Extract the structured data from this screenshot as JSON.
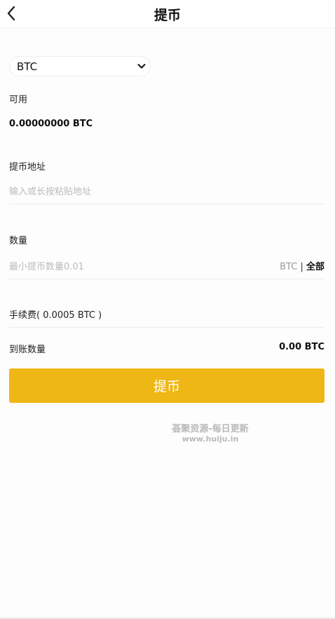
{
  "header": {
    "title": "提币"
  },
  "coin_select": {
    "value": "BTC"
  },
  "available": {
    "label": "可用",
    "balance": "0.00000000 BTC"
  },
  "address": {
    "label": "提币地址",
    "placeholder": "输入或长按粘贴地址"
  },
  "amount": {
    "label": "数量",
    "placeholder": "最小提币数量0.01",
    "unit": "BTC",
    "separator": "|",
    "all_label": "全部"
  },
  "fee": {
    "text": "手续费( 0.0005 BTC )"
  },
  "receive": {
    "label": "到账数量",
    "value": "0.00 BTC"
  },
  "submit_label": "提币",
  "watermark": {
    "line1": "荟聚资源-每日更新",
    "line2": "www.huiju.in"
  },
  "colors": {
    "accent": "#efb715"
  }
}
